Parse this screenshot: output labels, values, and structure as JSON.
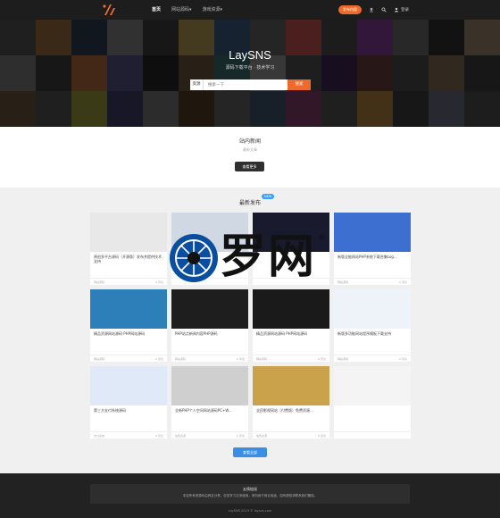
{
  "header": {
    "nav": [
      {
        "label": "首页",
        "active": true
      },
      {
        "label": "网站源码▾",
        "active": false
      },
      {
        "label": "游戏资源▾",
        "active": false
      }
    ],
    "publish_label": "发布内容",
    "login_label": "登录"
  },
  "hero": {
    "title": "LaySNS",
    "subtitle": "源码下载平台 · 技术学习",
    "search_scope": "资源",
    "search_placeholder": "搜索一下",
    "search_button": "搜索"
  },
  "news": {
    "title": "站内新闻",
    "subtitle": "最新文章",
    "more_label": "查看更多"
  },
  "latest": {
    "title": "最新发布",
    "badge": "NEW",
    "more_label": "查看全部",
    "cards": [
      {
        "title": "原创多平台源码（开源版）发布并提供技术支持",
        "tag": "网站源码",
        "count": "0 评论"
      },
      {
        "title": "",
        "tag": "",
        "count": ""
      },
      {
        "title": "",
        "tag": "",
        "count": ""
      },
      {
        "title": "新版全能网站PHP系统下载合集Log...",
        "tag": "网站源码",
        "count": "0 评论"
      },
      {
        "title": "精品资源网站源码 PHP网站源码",
        "tag": "网站源码",
        "count": "0 评论"
      },
      {
        "title": "PHP站点新闻内容PHP源码",
        "tag": "网站源码",
        "count": "0 评论"
      },
      {
        "title": "精品资源网站源码 PHP网站源码",
        "tag": "网站源码",
        "count": "0 评论"
      },
      {
        "title": "新版多功能网站程序模板下载支持",
        "tag": "网站源码",
        "count": "0 评论"
      },
      {
        "title": "第三方支付系统源码",
        "tag": "支付系统",
        "count": "0 评论"
      },
      {
        "title": "全新PHP个人空间网站源码PC+W...",
        "tag": "免费资源",
        "count": "0 评论"
      },
      {
        "title": "全民影视网站（付费版）免费资源...",
        "tag": "免费资源",
        "count": "0 评论"
      },
      {
        "title": "",
        "tag": "",
        "count": ""
      }
    ]
  },
  "watermark": {
    "text": "罗网",
    "reg": "®"
  },
  "footer": {
    "title": "友情链接",
    "text": "本站所有资源均由网友分享，仅供学习交流使用，请勿用于商业用途，如有侵权请联系我们删除。",
    "copyright": "LaySNS 2019 © laysns.com"
  },
  "colors": {
    "accent": "#ee6a2a",
    "blue": "#3a8ee6",
    "dark": "#1d1d1d"
  }
}
